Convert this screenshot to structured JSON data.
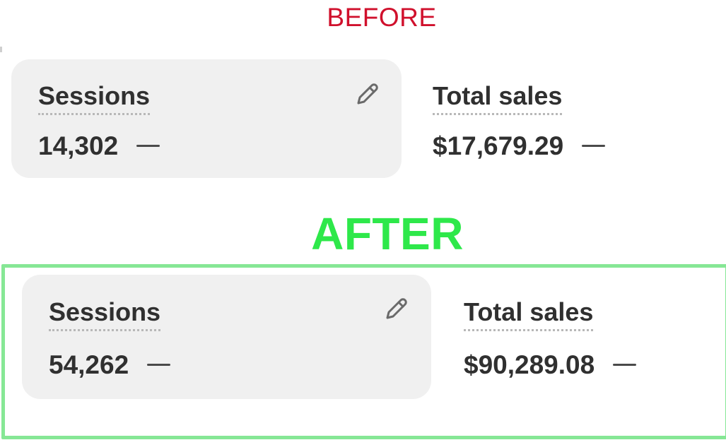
{
  "before": {
    "heading": "BEFORE",
    "sessions": {
      "title": "Sessions",
      "value": "14,302"
    },
    "total_sales": {
      "title": "Total sales",
      "value": "$17,679.29"
    }
  },
  "after": {
    "heading": "AFTER",
    "sessions": {
      "title": "Sessions",
      "value": "54,262"
    },
    "total_sales": {
      "title": "Total sales",
      "value": "$90,289.08"
    }
  },
  "icons": {
    "edit": "pencil-icon",
    "trend": "dash-icon"
  },
  "colors": {
    "before_heading": "#d0102c",
    "after_heading": "#2ee84a",
    "after_frame": "#86e795",
    "card_background": "#f0f0f0",
    "text": "#303030"
  }
}
